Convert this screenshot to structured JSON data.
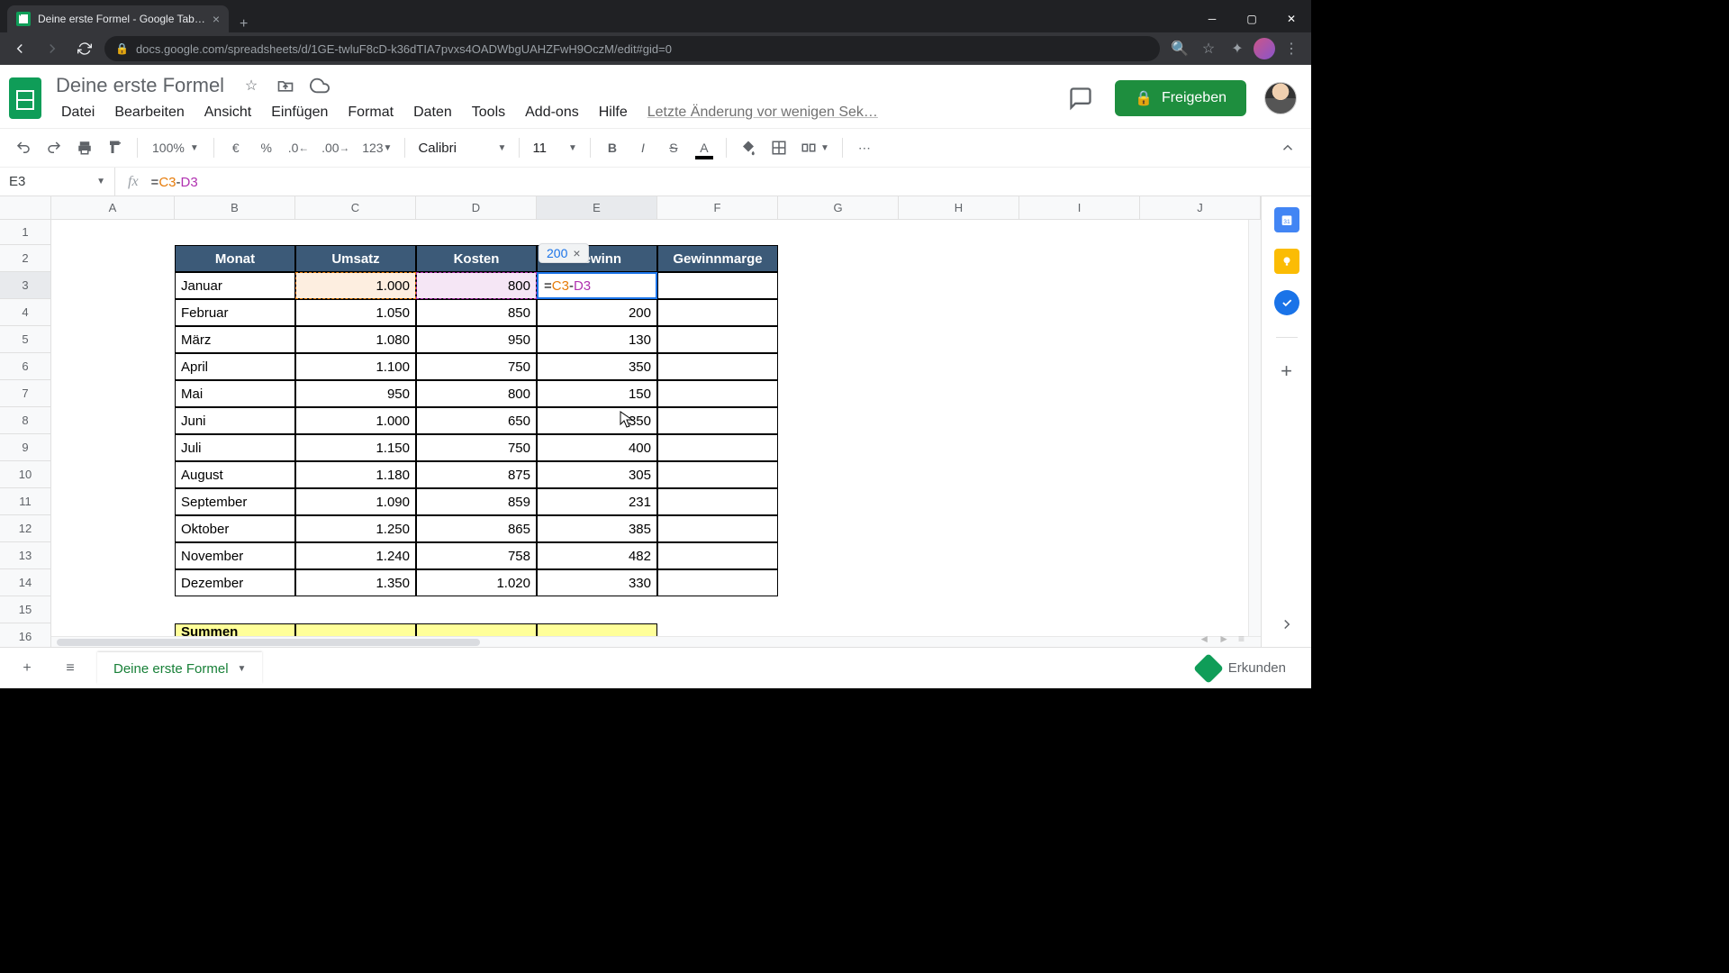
{
  "browser": {
    "tab_title": "Deine erste Formel - Google Tab…",
    "url": "docs.google.com/spreadsheets/d/1GE-twluF8cD-k36dTIA7pvxs4OADWbgUAHZFwH9OczM/edit#gid=0"
  },
  "doc": {
    "title": "Deine erste Formel",
    "last_edit": "Letzte Änderung vor wenigen Sek…",
    "share_label": "Freigeben"
  },
  "menubar": [
    "Datei",
    "Bearbeiten",
    "Ansicht",
    "Einfügen",
    "Format",
    "Daten",
    "Tools",
    "Add-ons",
    "Hilfe"
  ],
  "toolbar": {
    "zoom": "100%",
    "font": "Calibri",
    "font_size": "11",
    "num_fmt": "123"
  },
  "namebox": "E3",
  "formula": {
    "prefix": "=",
    "ref1": "C3",
    "op": "-",
    "ref2": "D3"
  },
  "columns": [
    "A",
    "B",
    "C",
    "D",
    "E",
    "F",
    "G",
    "H",
    "I",
    "J"
  ],
  "rows": [
    "1",
    "2",
    "3",
    "4",
    "5",
    "6",
    "7",
    "8",
    "9",
    "10",
    "11",
    "12",
    "13",
    "14",
    "15",
    "16"
  ],
  "headers": {
    "B": "Monat",
    "C": "Umsatz",
    "D": "Kosten",
    "E": "Gewinn",
    "F": "Gewinnmarge"
  },
  "hint_value": "200",
  "summen_label": "Summen",
  "data_rows": [
    {
      "monat": "Januar",
      "umsatz": "1.000",
      "kosten": "800",
      "gewinn": "=C3-D3"
    },
    {
      "monat": "Februar",
      "umsatz": "1.050",
      "kosten": "850",
      "gewinn": "200"
    },
    {
      "monat": "März",
      "umsatz": "1.080",
      "kosten": "950",
      "gewinn": "130"
    },
    {
      "monat": "April",
      "umsatz": "1.100",
      "kosten": "750",
      "gewinn": "350"
    },
    {
      "monat": "Mai",
      "umsatz": "950",
      "kosten": "800",
      "gewinn": "150"
    },
    {
      "monat": "Juni",
      "umsatz": "1.000",
      "kosten": "650",
      "gewinn": "350"
    },
    {
      "monat": "Juli",
      "umsatz": "1.150",
      "kosten": "750",
      "gewinn": "400"
    },
    {
      "monat": "August",
      "umsatz": "1.180",
      "kosten": "875",
      "gewinn": "305"
    },
    {
      "monat": "September",
      "umsatz": "1.090",
      "kosten": "859",
      "gewinn": "231"
    },
    {
      "monat": "Oktober",
      "umsatz": "1.250",
      "kosten": "865",
      "gewinn": "385"
    },
    {
      "monat": "November",
      "umsatz": "1.240",
      "kosten": "758",
      "gewinn": "482"
    },
    {
      "monat": "Dezember",
      "umsatz": "1.350",
      "kosten": "1.020",
      "gewinn": "330"
    }
  ],
  "sheet_tab": "Deine erste Formel",
  "explore_label": "Erkunden"
}
